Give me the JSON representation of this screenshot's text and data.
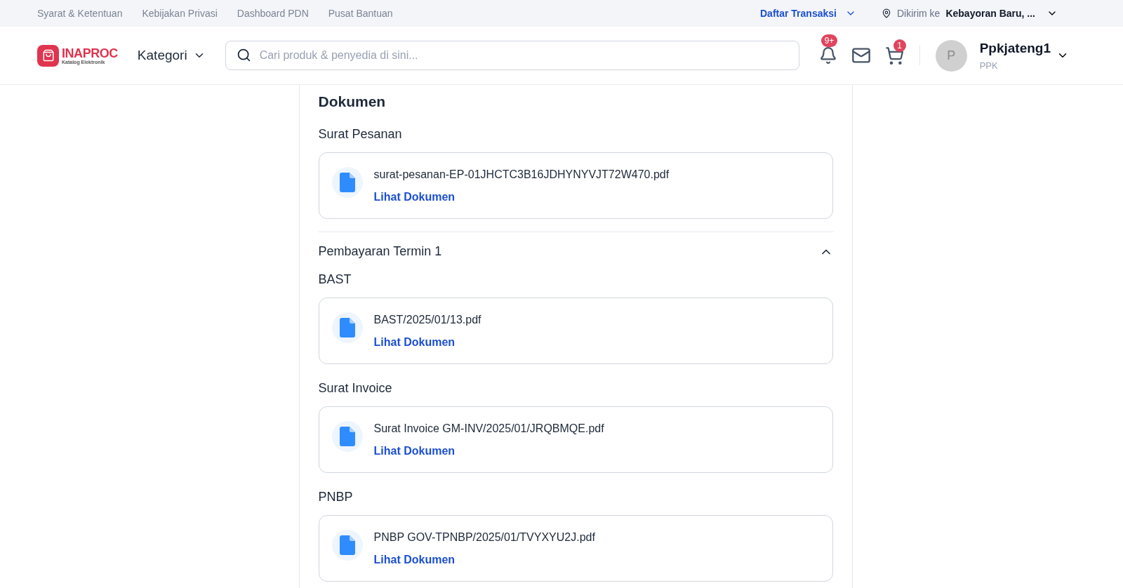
{
  "top_links": [
    "Syarat & Ketentuan",
    "Kebijakan Privasi",
    "Dashboard PDN",
    "Pusat Bantuan"
  ],
  "transactions_menu": "Daftar Transaksi",
  "delivery": {
    "label": "Dikirim ke",
    "location": "Kebayoran Baru, ..."
  },
  "logo": {
    "name": "INAPROC",
    "tagline": "Katalog Elektronik"
  },
  "category_menu": "Kategori",
  "search": {
    "placeholder": "Cari produk & penyedia di sini..."
  },
  "notifications_badge": "9+",
  "cart_badge": "1",
  "user": {
    "initial": "P",
    "name": "Ppkjateng1",
    "role": "PPK"
  },
  "section_title": "Dokumen",
  "order_group": {
    "title": "Surat Pesanan",
    "files": [
      {
        "name": "surat-pesanan-EP-01JHCTC3B16JDHYNYVJT72W470.pdf",
        "link": "Lihat Dokumen"
      }
    ]
  },
  "payment": {
    "title": "Pembayaran Termin 1",
    "expanded": true,
    "groups": [
      {
        "title": "BAST",
        "files": [
          {
            "name": "BAST/2025/01/13.pdf",
            "link": "Lihat Dokumen"
          }
        ]
      },
      {
        "title": "Surat Invoice",
        "files": [
          {
            "name": "Surat Invoice GM-INV/2025/01/JRQBMQE.pdf",
            "link": "Lihat Dokumen"
          }
        ]
      },
      {
        "title": "PNBP",
        "files": [
          {
            "name": "PNBP GOV-TPNBP/2025/01/TVYXYU2J.pdf",
            "link": "Lihat Dokumen"
          }
        ]
      }
    ]
  }
}
